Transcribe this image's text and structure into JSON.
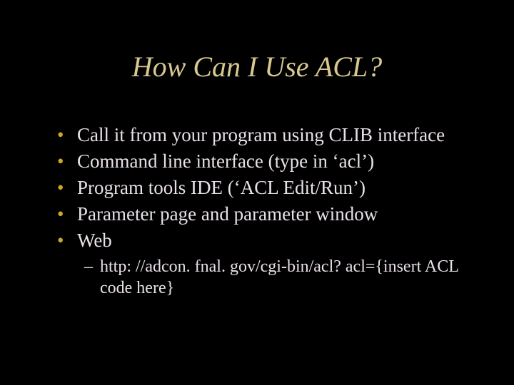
{
  "title": "How Can I Use ACL?",
  "bullets": [
    "Call it from your program using CLIB interface",
    "Command line interface (type in ‘acl’)",
    "Program tools IDE (‘ACL Edit/Run’)",
    "Parameter page and parameter window",
    "Web"
  ],
  "sub_bullet": "http: //adcon. fnal. gov/cgi-bin/acl? acl={insert ACL code here}"
}
